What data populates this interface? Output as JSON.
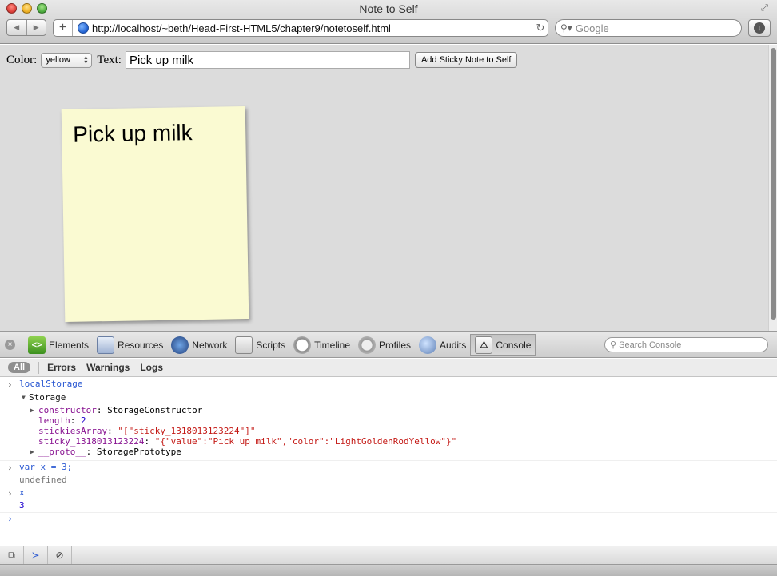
{
  "window": {
    "title": "Note to Self",
    "url": "http://localhost/~beth/Head-First-HTML5/chapter9/notetoself.html",
    "search_placeholder": "Google"
  },
  "form": {
    "color_label": "Color:",
    "color_value": "yellow",
    "text_label": "Text:",
    "text_value": "Pick up milk",
    "add_button": "Add Sticky Note to Self"
  },
  "sticky": {
    "text": "Pick up milk",
    "color": "#fafad2"
  },
  "inspector": {
    "panels": [
      {
        "label": "Elements",
        "icon": "elements-icon"
      },
      {
        "label": "Resources",
        "icon": "resources-icon"
      },
      {
        "label": "Network",
        "icon": "network-icon"
      },
      {
        "label": "Scripts",
        "icon": "scripts-icon"
      },
      {
        "label": "Timeline",
        "icon": "timeline-icon"
      },
      {
        "label": "Profiles",
        "icon": "profiles-icon"
      },
      {
        "label": "Audits",
        "icon": "audits-icon"
      },
      {
        "label": "Console",
        "icon": "console-icon"
      }
    ],
    "search_placeholder": "Search Console",
    "active_panel": "Console"
  },
  "filters": {
    "all": "All",
    "errors": "Errors",
    "warnings": "Warnings",
    "logs": "Logs"
  },
  "console": {
    "cmd1": "localStorage",
    "storage_label": "Storage",
    "constructor_key": "constructor",
    "constructor_val": "StorageConstructor",
    "length_key": "length",
    "length_val": "2",
    "stickies_key": "stickiesArray",
    "stickies_val": "\"[\"sticky_1318013123224\"]\"",
    "sticky_key": "sticky_1318013123224",
    "sticky_val": "\"{\"value\":\"Pick up milk\",\"color\":\"LightGoldenRodYellow\"}\"",
    "proto_key": "__proto__",
    "proto_val": "StoragePrototype",
    "cmd2": "var x = 3;",
    "out2": "undefined",
    "cmd3": "x",
    "out3": "3"
  },
  "colors": {
    "accent": "#2a58d2",
    "string": "#c41a16",
    "property": "#881391",
    "page_bg": "#dcdcdc"
  }
}
